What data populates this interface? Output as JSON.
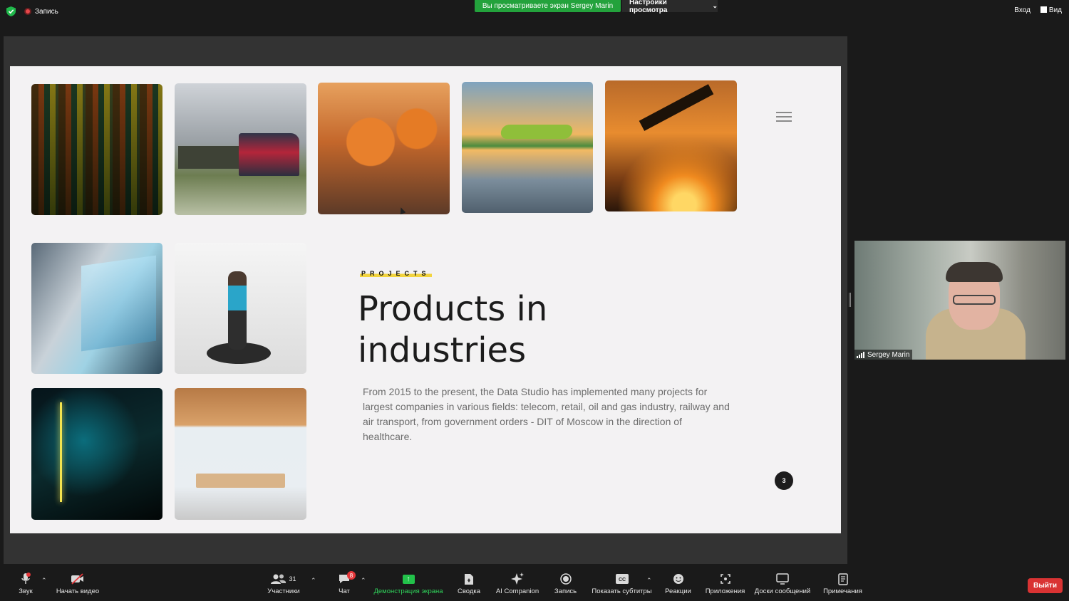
{
  "top_bar": {
    "recording_label": "Запись",
    "viewing_banner": "Вы просматриваете экран Sergey Marin",
    "view_settings_label": "Настройки просмотра",
    "signin_label": "Вход",
    "view_label": "Вид"
  },
  "slide": {
    "tag": "PROJECTS",
    "title": "Products in industries",
    "body": "From 2015 to the present, the Data Studio has implemented many projects for largest companies in various fields: telecom, retail, oil and gas industry, railway and air transport, from government orders - DIT of Moscow in the direction of healthcare.",
    "page_number": "3",
    "accent_color": "#f2d43f",
    "photos": [
      "rail-yard",
      "freight-train",
      "industrial-robots",
      "green-airplane",
      "excavator-sunset",
      "doctor-hologram",
      "vr-treadmill",
      "digital-retail",
      "electronics-store"
    ]
  },
  "speaker": {
    "name": "Sergey Marin"
  },
  "toolbar": {
    "audio": "Звук",
    "video": "Начать видео",
    "participants": "Участники",
    "participants_count": "31",
    "chat": "Чат",
    "chat_badge": "8",
    "share": "Демонстрация экрана",
    "summary": "Сводка",
    "ai": "AI Companion",
    "record": "Запись",
    "captions": "Показать субтитры",
    "reactions": "Реакции",
    "apps": "Приложения",
    "whiteboards": "Доски сообщений",
    "notes": "Примечания",
    "leave": "Выйти"
  },
  "colors": {
    "share_green": "#22c24a",
    "leave_red": "#d93333"
  }
}
